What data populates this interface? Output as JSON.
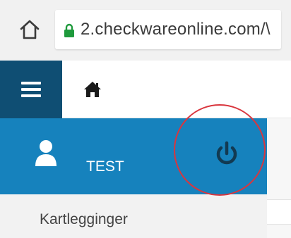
{
  "browser": {
    "url": "2.checkwareonline.com/\\"
  },
  "header": {
    "menu_icon": "hamburger-menu-icon",
    "home_icon": "home-icon"
  },
  "user": {
    "name": "TEST",
    "icon": "user-icon",
    "power_icon": "power-icon"
  },
  "menu": {
    "items": [
      {
        "label": "Kartlegginger"
      }
    ]
  },
  "colors": {
    "header_dark": "#0f4e73",
    "user_panel": "#1682bd",
    "annotation": "#d9363e"
  }
}
